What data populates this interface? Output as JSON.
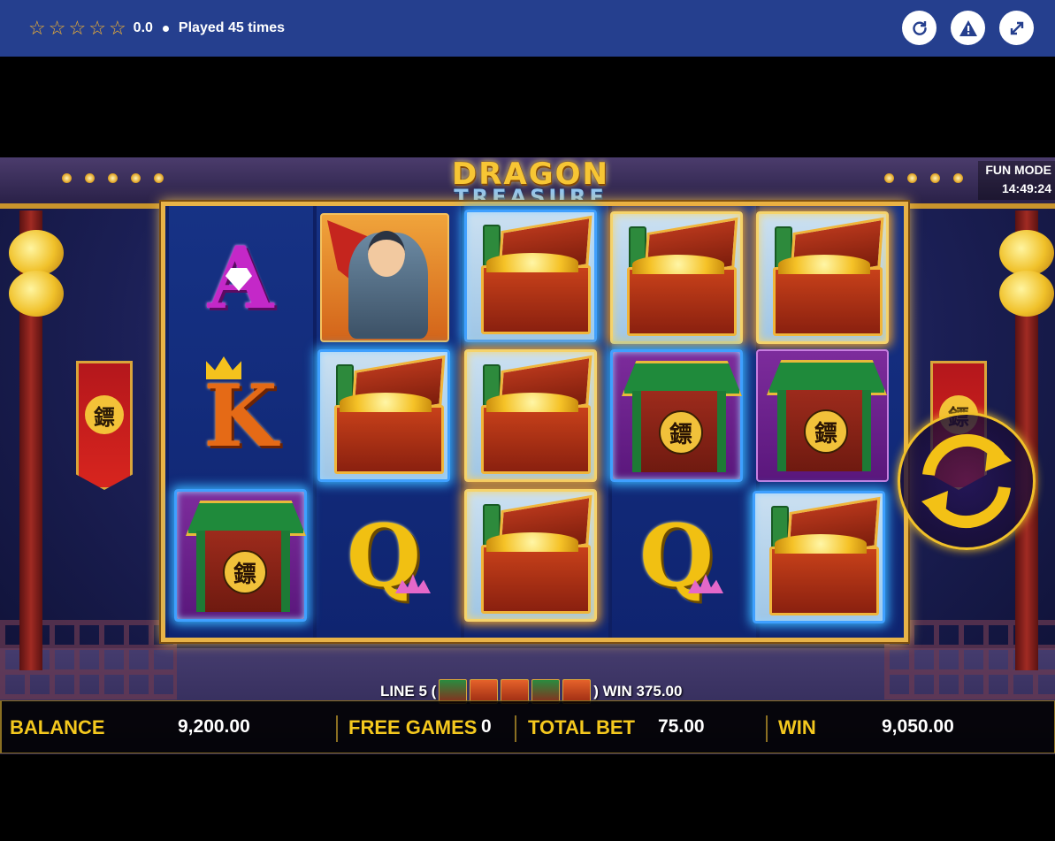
{
  "header": {
    "stars": [
      "☆",
      "☆",
      "☆",
      "☆",
      "☆"
    ],
    "rating": "0.0",
    "played": "Played 45 times",
    "buttons": [
      {
        "name": "reload-icon"
      },
      {
        "name": "report-icon"
      },
      {
        "name": "fullscreen-icon"
      }
    ],
    "bar_color": "#253f8e"
  },
  "game": {
    "logo_line1": "DRAGON",
    "logo_line2": "TREASURE",
    "mode": "FUN MODE",
    "clock": "14:49:24",
    "reels": [
      [
        "A",
        "K",
        "TEMPLE"
      ],
      [
        "WARRIOR",
        "CHEST",
        "Q"
      ],
      [
        "CHEST",
        "CHEST",
        "CHEST"
      ],
      [
        "CHEST",
        "TEMPLE",
        "Q"
      ],
      [
        "CHEST",
        "TEMPLE",
        "CHEST"
      ]
    ],
    "line_info": {
      "prefix": "LINE 5 (",
      "suffix": ") WIN 375.00",
      "symbols": [
        "TEMPLE",
        "CHEST",
        "CHEST",
        "TEMPLE",
        "CHEST"
      ]
    }
  },
  "status": {
    "balance_label": "BALANCE",
    "balance": "9,200.00",
    "free_games_label": "FREE GAMES",
    "free_games": "0",
    "total_bet_label": "TOTAL BET",
    "total_bet": "75.00",
    "win_label": "WIN",
    "win": "9,050.00"
  }
}
